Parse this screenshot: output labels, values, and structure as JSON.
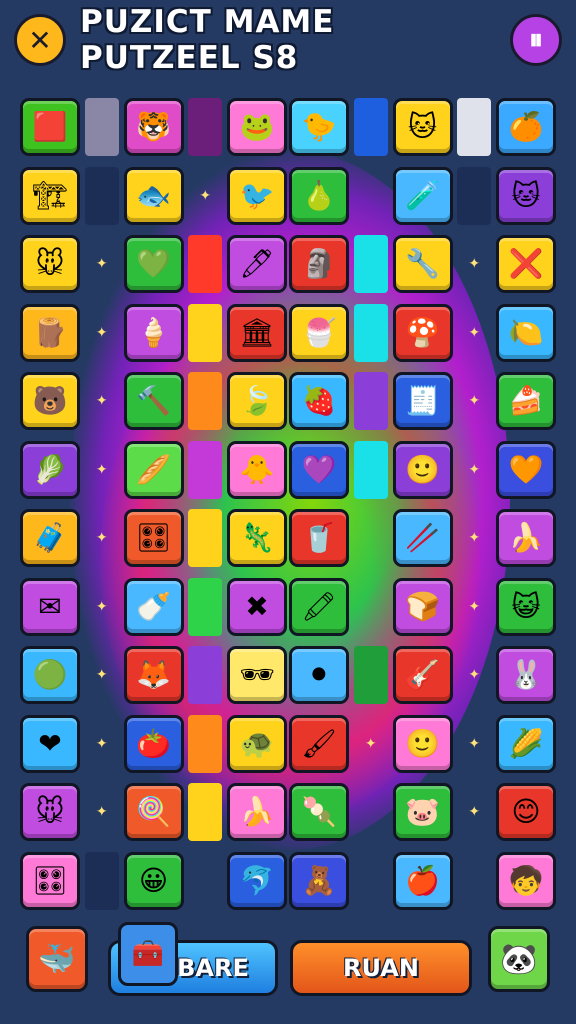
{
  "header": {
    "title": "PUZICT MAME PUTZEEL S8",
    "close_label": "✕",
    "pause_label": "⏸"
  },
  "board": {
    "rows": [
      [
        {
          "k": "tile",
          "c": "#3ec21f",
          "i": "🟥",
          "n": "flag-icon"
        },
        {
          "k": "strip",
          "c": "#8a86a6"
        },
        {
          "k": "tile",
          "c": "#e04cc8",
          "i": "🐯",
          "n": "tiger-icon"
        },
        {
          "k": "strip",
          "c": "#6b1f7a"
        },
        {
          "k": "tile",
          "c": "#ff7ad6",
          "i": "🐸",
          "n": "frog-icon"
        },
        {
          "k": "tile",
          "c": "#4ad2ff",
          "i": "🐤",
          "n": "bird-icon"
        },
        {
          "k": "strip",
          "c": "#1e5fe0"
        },
        {
          "k": "tile",
          "c": "#ffd21c",
          "i": "🐱",
          "n": "cat-icon"
        },
        {
          "k": "strip",
          "c": "#dfe2ea"
        },
        {
          "k": "tile",
          "c": "#3aa9ff",
          "i": "🍊",
          "n": "orange-icon"
        }
      ],
      [
        {
          "k": "tile",
          "c": "#ffd21c",
          "i": "🏗",
          "n": "crane-icon"
        },
        {
          "k": "strip",
          "c": "#1c2e55"
        },
        {
          "k": "tile",
          "c": "#ffd21c",
          "i": "🐟",
          "n": "fish-icon"
        },
        {
          "k": "spark"
        },
        {
          "k": "tile",
          "c": "#ffd21c",
          "i": "🐦",
          "n": "bluebird-icon"
        },
        {
          "k": "tile",
          "c": "#2fbd3c",
          "i": "🍐",
          "n": "pear-icon"
        },
        {
          "k": "empty"
        },
        {
          "k": "tile",
          "c": "#4ab8ff",
          "i": "🧪",
          "n": "potion-icon"
        },
        {
          "k": "strip",
          "c": "#1c2e55"
        },
        {
          "k": "tile",
          "c": "#8b3fd8",
          "i": "🐱",
          "n": "white-cat-icon"
        }
      ],
      [
        {
          "k": "tile",
          "c": "#ffd21c",
          "i": "🐭",
          "n": "mouse-icon"
        },
        {
          "k": "spark"
        },
        {
          "k": "tile",
          "c": "#2fbd3c",
          "i": "💚",
          "n": "heart-icon"
        },
        {
          "k": "strip",
          "c": "#ff3a2a"
        },
        {
          "k": "tile",
          "c": "#c04ce0",
          "i": "🖊",
          "n": "pen-icon"
        },
        {
          "k": "tile",
          "c": "#e8362a",
          "i": "🗿",
          "n": "statue-icon"
        },
        {
          "k": "strip",
          "c": "#1ae0e8"
        },
        {
          "k": "tile",
          "c": "#ffd21c",
          "i": "🔧",
          "n": "wrench-icon"
        },
        {
          "k": "spark"
        },
        {
          "k": "tile",
          "c": "#ffd21c",
          "i": "❌",
          "n": "crossed-tools-icon"
        }
      ],
      [
        {
          "k": "tile",
          "c": "#ffb81c",
          "i": "🪵",
          "n": "barrel-icon"
        },
        {
          "k": "spark"
        },
        {
          "k": "tile",
          "c": "#c04ce0",
          "i": "🍦",
          "n": "icecream-icon"
        },
        {
          "k": "strip",
          "c": "#ffd21c"
        },
        {
          "k": "tile",
          "c": "#e8362a",
          "i": "🏛",
          "n": "building-icon"
        },
        {
          "k": "tile",
          "c": "#ffd21c",
          "i": "🍧",
          "n": "cone-icon"
        },
        {
          "k": "strip",
          "c": "#1ae0e8"
        },
        {
          "k": "tile",
          "c": "#e8362a",
          "i": "🍄",
          "n": "leaf-icon"
        },
        {
          "k": "spark"
        },
        {
          "k": "tile",
          "c": "#3ab8ff",
          "i": "🍋",
          "n": "lemon-icon"
        }
      ],
      [
        {
          "k": "tile",
          "c": "#ffd21c",
          "i": "🐻",
          "n": "bear-icon"
        },
        {
          "k": "spark"
        },
        {
          "k": "tile",
          "c": "#2fbd3c",
          "i": "🔨",
          "n": "hammer-icon"
        },
        {
          "k": "strip",
          "c": "#ff8a1c"
        },
        {
          "k": "tile",
          "c": "#ffd21c",
          "i": "🍃",
          "n": "green-leaf-icon"
        },
        {
          "k": "tile",
          "c": "#3ab8ff",
          "i": "🍓",
          "n": "strawberry-icon"
        },
        {
          "k": "strip",
          "c": "#8b3fd8"
        },
        {
          "k": "tile",
          "c": "#2a5fe0",
          "i": "🧾",
          "n": "ticket-icon"
        },
        {
          "k": "spark"
        },
        {
          "k": "tile",
          "c": "#2fbd3c",
          "i": "🍰",
          "n": "cake-icon"
        }
      ],
      [
        {
          "k": "tile",
          "c": "#8b3fd8",
          "i": "🥬",
          "n": "lettuce-icon"
        },
        {
          "k": "spark"
        },
        {
          "k": "tile",
          "c": "#5ddc4a",
          "i": "🥖",
          "n": "baguette-icon"
        },
        {
          "k": "strip",
          "c": "#c43ad8"
        },
        {
          "k": "tile",
          "c": "#ff7ad6",
          "i": "🐥",
          "n": "chick-icon"
        },
        {
          "k": "tile",
          "c": "#2a5fe0",
          "i": "💜",
          "n": "pink-heart-icon"
        },
        {
          "k": "strip",
          "c": "#1ae0e8"
        },
        {
          "k": "tile",
          "c": "#8b3fd8",
          "i": "🙂",
          "n": "smiley-icon"
        },
        {
          "k": "spark"
        },
        {
          "k": "tile",
          "c": "#3a4fe0",
          "i": "🧡",
          "n": "orange-heart-icon"
        }
      ],
      [
        {
          "k": "tile",
          "c": "#ffb81c",
          "i": "🧳",
          "n": "suitcase-icon"
        },
        {
          "k": "spark"
        },
        {
          "k": "tile",
          "c": "#f05a2a",
          "i": "🎛",
          "n": "console-icon"
        },
        {
          "k": "strip",
          "c": "#ffd21c"
        },
        {
          "k": "tile",
          "c": "#ffd21c",
          "i": "🦎",
          "n": "lizard-icon"
        },
        {
          "k": "tile",
          "c": "#e8362a",
          "i": "🥤",
          "n": "cup-icon"
        },
        {
          "k": "empty"
        },
        {
          "k": "tile",
          "c": "#4ab8ff",
          "i": "🥢",
          "n": "stick-icon"
        },
        {
          "k": "spark"
        },
        {
          "k": "tile",
          "c": "#c04ce0",
          "i": "🍌",
          "n": "banana-icon"
        }
      ],
      [
        {
          "k": "tile",
          "c": "#c04ce0",
          "i": "✉",
          "n": "envelope-icon"
        },
        {
          "k": "spark"
        },
        {
          "k": "tile",
          "c": "#4ab8ff",
          "i": "🍼",
          "n": "bottle-icon"
        },
        {
          "k": "strip",
          "c": "#2fd34a"
        },
        {
          "k": "tile",
          "c": "#c04ce0",
          "i": "✖",
          "n": "cross-icon"
        },
        {
          "k": "tile",
          "c": "#2fbd3c",
          "i": "🖍",
          "n": "crayon-icon"
        },
        {
          "k": "empty"
        },
        {
          "k": "tile",
          "c": "#c04ce0",
          "i": "🍞",
          "n": "bread-icon"
        },
        {
          "k": "spark"
        },
        {
          "k": "tile",
          "c": "#2fbd3c",
          "i": "😺",
          "n": "pink-cat-icon"
        }
      ],
      [
        {
          "k": "tile",
          "c": "#3ab8ff",
          "i": "🟢",
          "n": "green-blob-icon"
        },
        {
          "k": "spark"
        },
        {
          "k": "tile",
          "c": "#e8362a",
          "i": "🦊",
          "n": "fox-icon"
        },
        {
          "k": "strip",
          "c": "#8b3fd8"
        },
        {
          "k": "tile",
          "c": "#ffe86a",
          "i": "🕶",
          "n": "goggles-icon"
        },
        {
          "k": "tile",
          "c": "#4ab8ff",
          "i": "⚫",
          "n": "dots-icon"
        },
        {
          "k": "strip",
          "c": "#1f9e3a"
        },
        {
          "k": "tile",
          "c": "#e8362a",
          "i": "🎸",
          "n": "guitar-icon"
        },
        {
          "k": "spark"
        },
        {
          "k": "tile",
          "c": "#c04ce0",
          "i": "🐰",
          "n": "bunny-icon"
        }
      ],
      [
        {
          "k": "tile",
          "c": "#3ab8ff",
          "i": "❤",
          "n": "red-heart-icon"
        },
        {
          "k": "spark"
        },
        {
          "k": "tile",
          "c": "#2a5fe0",
          "i": "🍅",
          "n": "tomato-icon"
        },
        {
          "k": "strip",
          "c": "#ff8a1c"
        },
        {
          "k": "tile",
          "c": "#ffd21c",
          "i": "🐢",
          "n": "turtle-icon"
        },
        {
          "k": "tile",
          "c": "#e8362a",
          "i": "🖌",
          "n": "brush-icon"
        },
        {
          "k": "spark"
        },
        {
          "k": "tile",
          "c": "#ff7ad6",
          "i": "🙂",
          "n": "kid-icon"
        },
        {
          "k": "spark"
        },
        {
          "k": "tile",
          "c": "#3ab8ff",
          "i": "🌽",
          "n": "corn-icon"
        }
      ],
      [
        {
          "k": "tile",
          "c": "#c04ce0",
          "i": "🐭",
          "n": "gray-mouse-icon"
        },
        {
          "k": "spark"
        },
        {
          "k": "tile",
          "c": "#f05a2a",
          "i": "🍭",
          "n": "lollipop-icon"
        },
        {
          "k": "strip",
          "c": "#ffd21c"
        },
        {
          "k": "tile",
          "c": "#ff7ad6",
          "i": "🍌",
          "n": "yellow-fruit-icon"
        },
        {
          "k": "tile",
          "c": "#2fbd3c",
          "i": "🍡",
          "n": "skewer-icon"
        },
        {
          "k": "empty"
        },
        {
          "k": "tile",
          "c": "#2fbd3c",
          "i": "🐷",
          "n": "pig-icon"
        },
        {
          "k": "spark"
        },
        {
          "k": "tile",
          "c": "#e8362a",
          "i": "😊",
          "n": "yellow-face-icon"
        }
      ],
      [
        {
          "k": "tile",
          "c": "#ff7ad6",
          "i": "🎛",
          "n": "device-icon"
        },
        {
          "k": "strip",
          "c": "#1c2e55"
        },
        {
          "k": "tile",
          "c": "#2fbd3c",
          "i": "😀",
          "n": "happy-face-icon"
        },
        {
          "k": "empty"
        },
        {
          "k": "tile",
          "c": "#2a5fe0",
          "i": "🐬",
          "n": "dolphin-icon"
        },
        {
          "k": "tile",
          "c": "#3a4fe0",
          "i": "🧸",
          "n": "toy-icon"
        },
        {
          "k": "empty"
        },
        {
          "k": "tile",
          "c": "#4ab8ff",
          "i": "🍎",
          "n": "apple-icon"
        },
        {
          "k": "empty"
        },
        {
          "k": "tile",
          "c": "#ff7ad6",
          "i": "🧒",
          "n": "child-icon"
        }
      ]
    ]
  },
  "footer": {
    "share_label": "BARE",
    "run_label": "RUAN",
    "left_tile_icon": "🐳",
    "right_tile_icon": "🐼",
    "share_tile_icon": "🧰"
  }
}
